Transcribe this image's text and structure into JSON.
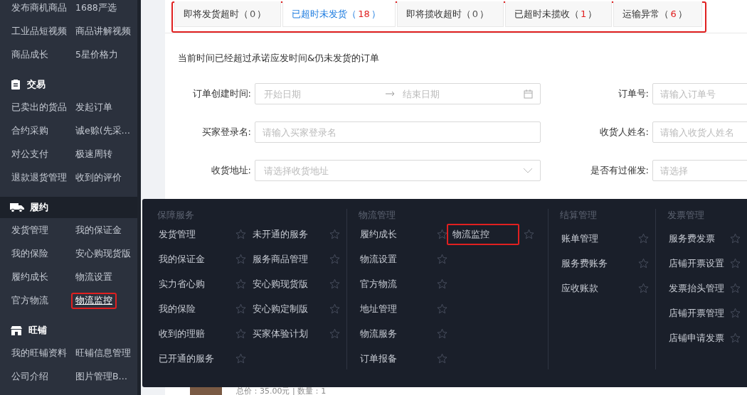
{
  "sidebar": {
    "sections": [
      {
        "items": [
          {
            "label": "发布商机商品",
            "highlighted": false
          },
          {
            "label": "1688严选",
            "highlighted": false
          },
          {
            "label": "工业品短视频",
            "highlighted": false
          },
          {
            "label": "商品讲解视频",
            "highlighted": false
          },
          {
            "label": "商品成长",
            "highlighted": false
          },
          {
            "label": "5星价格力",
            "highlighted": false
          }
        ]
      },
      {
        "title": "交易",
        "selected": false,
        "items": [
          {
            "label": "已卖出的货品",
            "highlighted": false
          },
          {
            "label": "发起订单",
            "highlighted": false
          },
          {
            "label": "合约采购",
            "highlighted": false
          },
          {
            "label": "诚e赊(先采…",
            "highlighted": false
          },
          {
            "label": "对公支付",
            "highlighted": false
          },
          {
            "label": "极速周转",
            "highlighted": false
          },
          {
            "label": "退款退货管理",
            "highlighted": false
          },
          {
            "label": "收到的评价",
            "highlighted": false
          }
        ]
      },
      {
        "title": "履约",
        "selected": true,
        "items": [
          {
            "label": "发货管理",
            "highlighted": false
          },
          {
            "label": "我的保证金",
            "highlighted": false
          },
          {
            "label": "我的保险",
            "highlighted": false
          },
          {
            "label": "安心购现货版",
            "highlighted": false
          },
          {
            "label": "履约成长",
            "highlighted": false
          },
          {
            "label": "物流设置",
            "highlighted": false
          },
          {
            "label": "官方物流",
            "highlighted": false
          },
          {
            "label": "物流监控",
            "highlighted": true
          }
        ]
      },
      {
        "title": "旺铺",
        "selected": false,
        "items": [
          {
            "label": "我的旺铺资料",
            "highlighted": false
          },
          {
            "label": "旺铺信息管理",
            "highlighted": false
          },
          {
            "label": "公司介绍",
            "highlighted": false
          },
          {
            "label": "图片管理B…",
            "highlighted": false
          }
        ]
      }
    ]
  },
  "tabs": {
    "highlighted": true,
    "items": [
      {
        "label": "即将发货超时（",
        "count": "0",
        "suffix": "）",
        "alert": false,
        "selected": false
      },
      {
        "label": "已超时未发货（",
        "count": "18",
        "suffix": "）",
        "alert": true,
        "selected": true
      },
      {
        "label": "即将揽收超时（",
        "count": "0",
        "suffix": "）",
        "alert": false,
        "selected": false
      },
      {
        "label": "已超时未揽收（",
        "count": "1",
        "suffix": "）",
        "alert": true,
        "selected": false
      },
      {
        "label": "运输异常（",
        "count": "6",
        "suffix": "）",
        "alert": true,
        "selected": false
      }
    ]
  },
  "description": "当前时间已经超过承诺应发时间&仍未发货的订单",
  "form": {
    "rows": [
      [
        {
          "kind": "daterange",
          "label": "订单创建时间:",
          "placeholder": "开始日期",
          "placeholder_end": "结束日期"
        },
        {
          "kind": "text",
          "label": "订单号:",
          "placeholder": "请输入订单号"
        }
      ],
      [
        {
          "kind": "text",
          "label": "买家登录名:",
          "placeholder": "请输入买家登录名"
        },
        {
          "kind": "text",
          "label": "收货人姓名:",
          "placeholder": "请输入收货人姓名"
        }
      ],
      [
        {
          "kind": "select",
          "label": "收货地址:",
          "placeholder": "请选择收货地址"
        },
        {
          "kind": "text",
          "label": "是否有过催发:",
          "placeholder": "请选择"
        }
      ]
    ]
  },
  "order": {
    "summary": "总价：35.00元 | 数量：1"
  },
  "menu": {
    "sections": [
      {
        "title": "保障服务",
        "columns": [
          [
            {
              "label": "发货管理",
              "highlighted": false,
              "starred": false
            },
            {
              "label": "我的保证金",
              "highlighted": false,
              "starred": false
            },
            {
              "label": "实力省心购",
              "highlighted": false,
              "starred": false
            },
            {
              "label": "我的保险",
              "highlighted": false,
              "starred": false
            },
            {
              "label": "收到的理赔",
              "highlighted": false,
              "starred": false
            },
            {
              "label": "已开通的服务",
              "highlighted": false,
              "starred": false
            }
          ],
          [
            {
              "label": "未开通的服务",
              "highlighted": false,
              "starred": false
            },
            {
              "label": "服务商品管理",
              "highlighted": false,
              "starred": false
            },
            {
              "label": "安心购现货版",
              "highlighted": false,
              "starred": false
            },
            {
              "label": "安心购定制版",
              "highlighted": false,
              "starred": false
            },
            {
              "label": "买家体验计划",
              "highlighted": false,
              "starred": false
            }
          ]
        ]
      },
      {
        "title": "物流管理",
        "columns": [
          [
            {
              "label": "履约成长",
              "highlighted": false,
              "starred": false
            },
            {
              "label": "物流设置",
              "highlighted": false,
              "starred": false
            },
            {
              "label": "官方物流",
              "highlighted": false,
              "starred": false
            },
            {
              "label": "地址管理",
              "highlighted": false,
              "starred": false
            },
            {
              "label": "物流服务",
              "highlighted": false,
              "starred": false
            },
            {
              "label": "订单报备",
              "highlighted": false,
              "starred": false
            }
          ],
          [
            {
              "label": "物流监控",
              "highlighted": true,
              "starred": false
            }
          ]
        ]
      },
      {
        "title": "结算管理",
        "columns": [
          [
            {
              "label": "账单管理",
              "highlighted": false,
              "starred": false
            },
            {
              "label": "服务费账务",
              "highlighted": false,
              "starred": false
            },
            {
              "label": "应收账款",
              "highlighted": false,
              "starred": false
            }
          ]
        ]
      },
      {
        "title": "发票管理",
        "columns": [
          [
            {
              "label": "服务费发票",
              "highlighted": false,
              "starred": false
            },
            {
              "label": "店铺开票设置",
              "highlighted": false,
              "starred": false
            },
            {
              "label": "发票抬头管理",
              "highlighted": false,
              "starred": false
            },
            {
              "label": "店铺开票管理",
              "highlighted": false,
              "starred": false
            },
            {
              "label": "店铺申请发票",
              "highlighted": false,
              "starred": false
            }
          ]
        ]
      }
    ]
  }
}
